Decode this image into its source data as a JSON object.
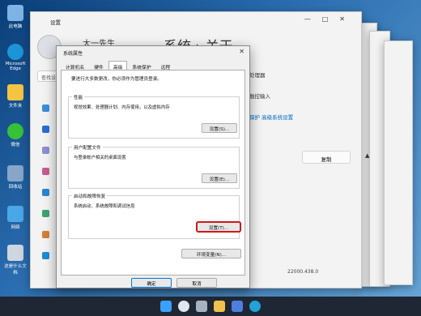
{
  "desktop": {
    "icons": [
      {
        "label": "此电脑",
        "icon": "pc-icon",
        "color": "#7fb3e6"
      },
      {
        "label": "Microsoft Edge",
        "icon": "edge-icon",
        "color": "#1d94d8"
      },
      {
        "label": "文件夹",
        "icon": "folder-icon",
        "color": "#f4c443"
      },
      {
        "label": "微信",
        "icon": "wechat-icon",
        "color": "#36c236"
      },
      {
        "label": "回收站",
        "icon": "recycle-icon",
        "color": "#87a6c8"
      },
      {
        "label": "网络",
        "icon": "network-icon",
        "color": "#4aa7e8"
      },
      {
        "label": "这是什么文档",
        "icon": "doc-icon",
        "color": "#cfd6df"
      }
    ]
  },
  "settings_window": {
    "title": "设置",
    "user_name": "大一先生",
    "search_placeholder": "查找设置",
    "header": "系统 › 关于",
    "rows": {
      "processor": "处理器",
      "input": "触控输入",
      "links": "保护    高级系统设置",
      "copy_button": "复制",
      "version": "22000.438.0"
    }
  },
  "dialog": {
    "title": "系统属性",
    "tabs": [
      "计算机名",
      "硬件",
      "高级",
      "系统保护",
      "远程"
    ],
    "active_tab": 2,
    "intro": "要进行大多数更改，你必须作为管理员登录。",
    "groups": [
      {
        "title": "性能",
        "desc": "视觉效果、处理器计划、内存使用，以及虚拟内存",
        "button": "设置(S)..."
      },
      {
        "title": "用户配置文件",
        "desc": "与登录帐户相关的桌面设置",
        "button": "设置(E)..."
      },
      {
        "title": "启动和故障恢复",
        "desc": "系统启动、系统故障和调试信息",
        "button": "设置(T)..."
      }
    ],
    "env_button": "环境变量(N)...",
    "ok_button": "确定",
    "cancel_button": "取消",
    "highlight_color": "#d21818"
  },
  "taskbar": {
    "icons": [
      "start-icon",
      "search-icon",
      "taskview-icon",
      "explorer-icon",
      "store-icon",
      "edge-icon"
    ]
  }
}
